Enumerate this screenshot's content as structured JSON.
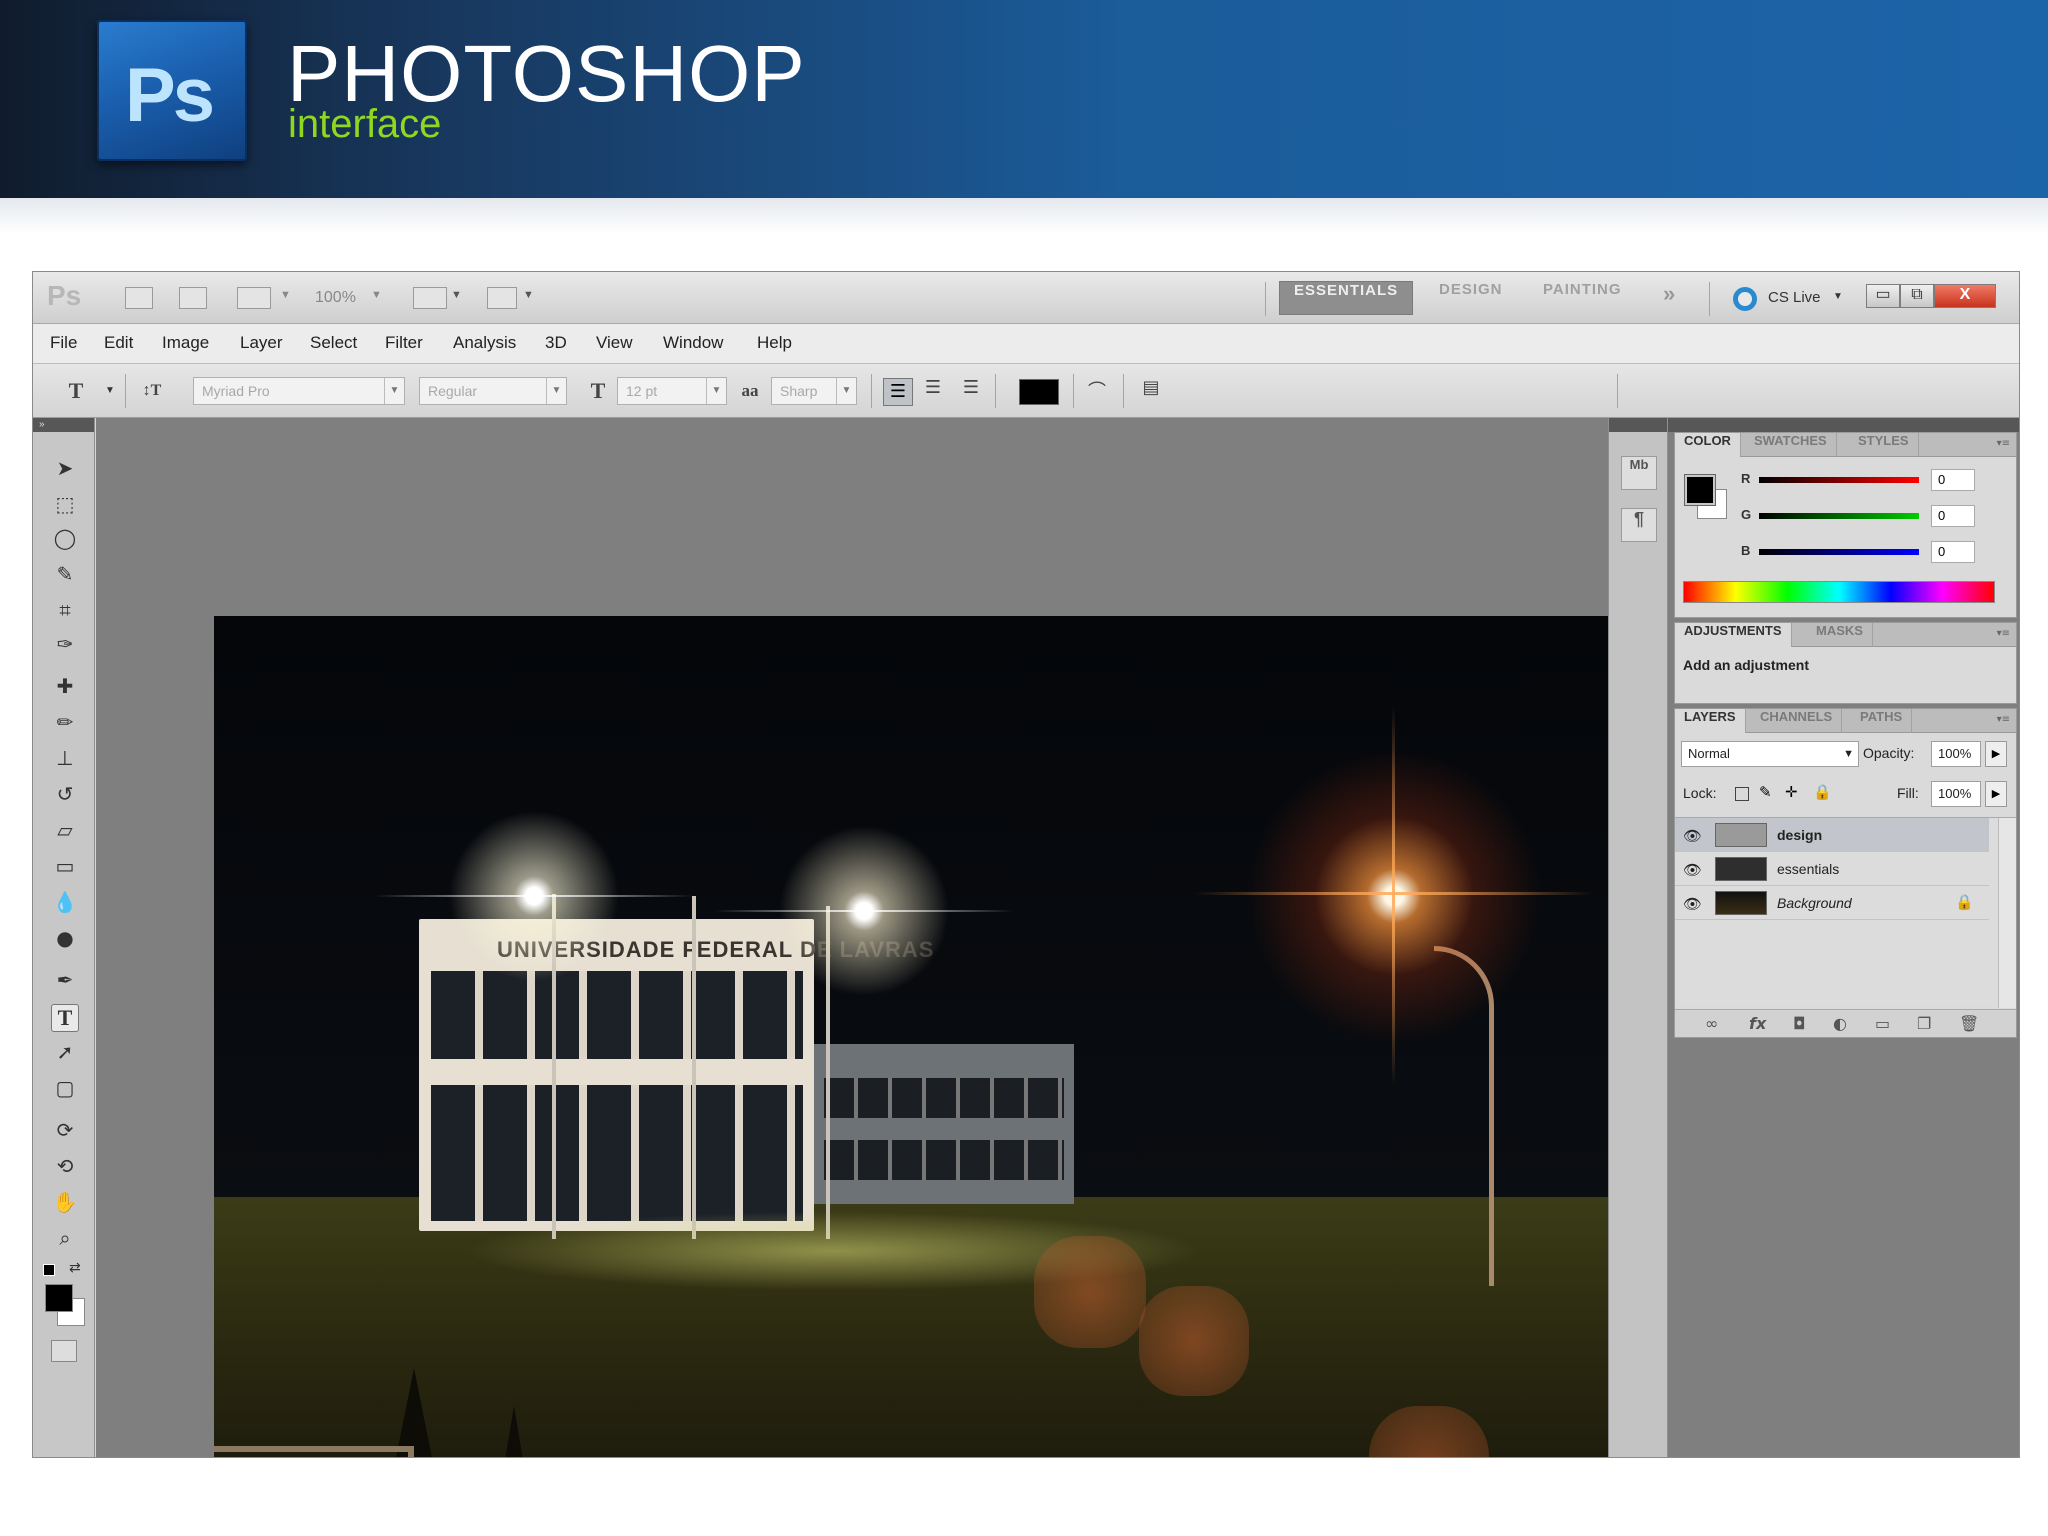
{
  "banner": {
    "logo_text": "Ps",
    "title": "PHOTOSHOP",
    "subtitle": "interface"
  },
  "appbar": {
    "logo": "Ps",
    "zoom": "100%",
    "workspaces": [
      "ESSENTIALS",
      "DESIGN",
      "PAINTING"
    ],
    "more": "»",
    "cslive": "CS Live",
    "window_buttons": {
      "minimize": "▭",
      "restore": "⧉",
      "close": "X"
    }
  },
  "menu": [
    "File",
    "Edit",
    "Image",
    "Layer",
    "Select",
    "Filter",
    "Analysis",
    "3D",
    "View",
    "Window",
    "Help"
  ],
  "options_bar": {
    "tool_icon": "T",
    "font_family": "Myriad Pro",
    "font_style": "Regular",
    "font_size": "12 pt",
    "antialias_icon": "aa",
    "antialias": "Sharp",
    "text_color": "#000000"
  },
  "tools": [
    "move-icon",
    "marquee-icon",
    "lasso-icon",
    "quick-select-icon",
    "crop-icon",
    "eyedropper-icon",
    "healing-brush-icon",
    "brush-icon",
    "clone-stamp-icon",
    "history-brush-icon",
    "eraser-icon",
    "gradient-icon",
    "blur-icon",
    "dodge-icon",
    "pen-icon",
    "type-icon",
    "path-select-icon",
    "shape-icon",
    "3d-rotate-icon",
    "3d-orbit-icon",
    "hand-icon",
    "zoom-icon"
  ],
  "photo": {
    "sign_text": "UNIVERSIDADE FEDERAL DE LAVRAS"
  },
  "dock": {
    "mb_label": "Mb",
    "char_label": "¶"
  },
  "color_panel": {
    "tabs": [
      "COLOR",
      "SWATCHES",
      "STYLES"
    ],
    "r_label": "R",
    "g_label": "G",
    "b_label": "B",
    "r": "0",
    "g": "0",
    "b": "0",
    "foreground": "#000000",
    "background": "#ffffff"
  },
  "adjustments_panel": {
    "tabs": [
      "ADJUSTMENTS",
      "MASKS"
    ],
    "text": "Add an adjustment"
  },
  "layers_panel": {
    "tabs": [
      "LAYERS",
      "CHANNELS",
      "PATHS"
    ],
    "blend_mode": "Normal",
    "opacity_label": "Opacity:",
    "opacity": "100%",
    "lock_label": "Lock:",
    "fill_label": "Fill:",
    "fill": "100%",
    "layers": [
      {
        "name": "design",
        "selected": true
      },
      {
        "name": "essentials",
        "selected": false
      },
      {
        "name": "Background",
        "selected": false
      }
    ],
    "footer_icons": [
      "link-icon",
      "fx-icon",
      "mask-icon",
      "adjustment-layer-icon",
      "group-icon",
      "new-layer-icon",
      "trash-icon"
    ]
  }
}
